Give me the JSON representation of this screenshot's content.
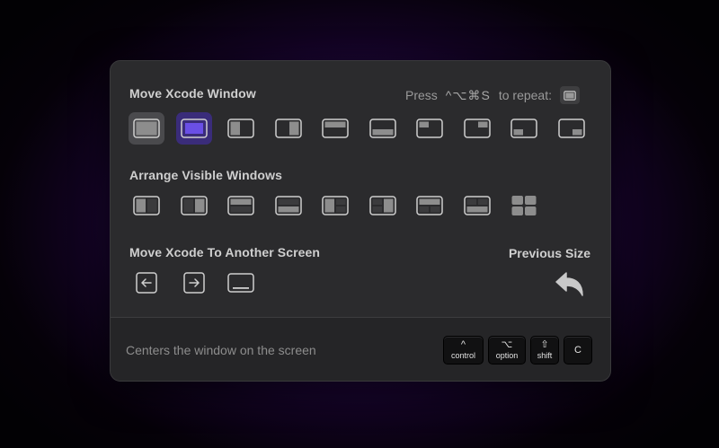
{
  "panel": {
    "move_title": "Move Xcode Window",
    "repeat": {
      "press": "Press",
      "combo": "^⌥⌘S",
      "to_repeat": "to repeat:"
    },
    "arrange_title": "Arrange Visible Windows",
    "screen_title": "Move Xcode To Another Screen",
    "prev_title": "Previous Size"
  },
  "move_layouts": [
    "maximize",
    "center",
    "left-half",
    "right-half",
    "top-half",
    "bottom-half",
    "top-left-quarter",
    "top-right-quarter",
    "bottom-left-quarter",
    "bottom-right-quarter"
  ],
  "arrange_layouts": [
    "left-right-split",
    "right-left-split",
    "top-bottom-split",
    "bottom-top-split",
    "left-with-right-stack",
    "right-with-left-stack",
    "top-with-bottom-pair",
    "bottom-with-top-pair",
    "four-grid"
  ],
  "screen_actions": [
    "previous-screen",
    "next-screen",
    "screen"
  ],
  "colors": {
    "accent": "#6a4fe6",
    "accent_bg": "#3a2c7a"
  },
  "footer": {
    "description": "Centers the window on the screen",
    "keys": [
      {
        "symbol": "^",
        "label": "control"
      },
      {
        "symbol": "⌥",
        "label": "option"
      },
      {
        "symbol": "⇧",
        "label": "shift"
      },
      {
        "symbol": "C",
        "label": ""
      }
    ]
  }
}
